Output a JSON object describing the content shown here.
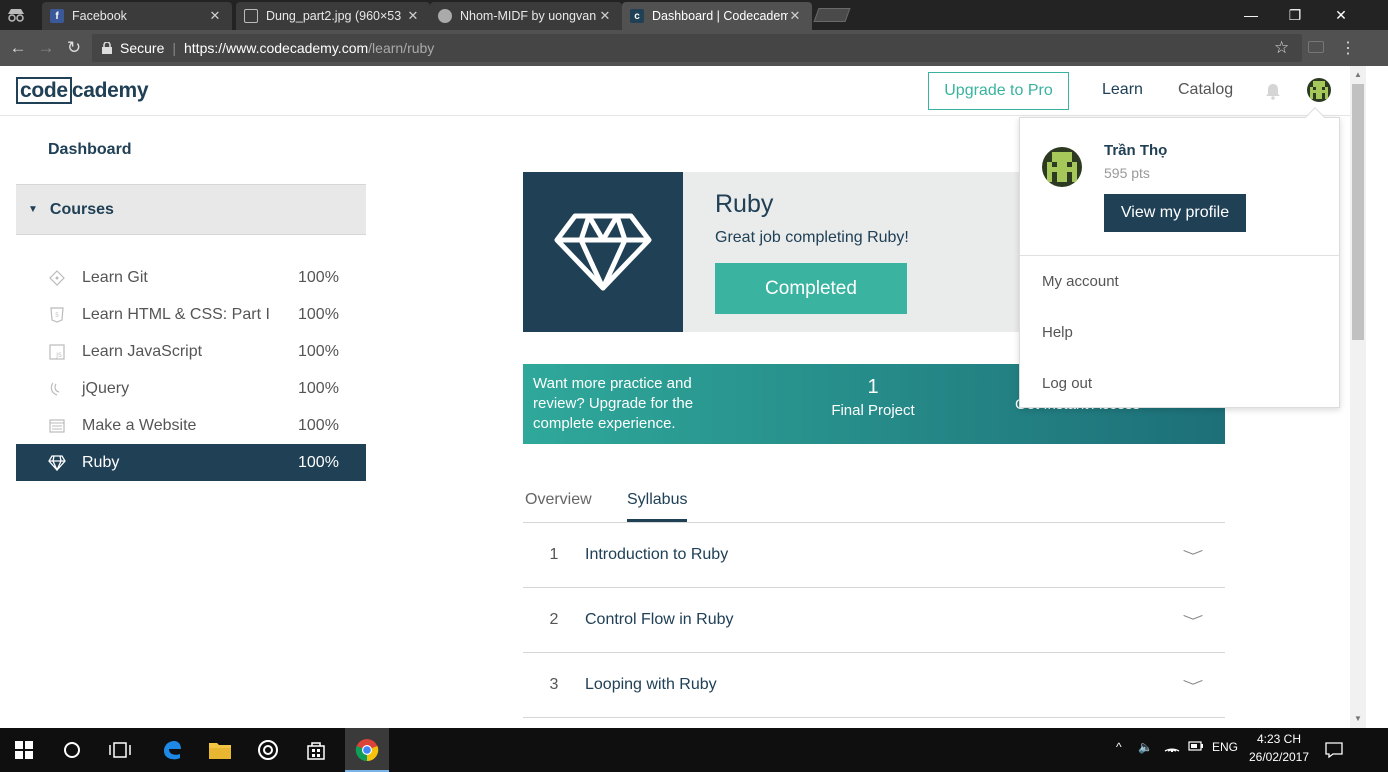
{
  "browser": {
    "tabs": [
      {
        "title": "Facebook",
        "favicon": "facebook-icon"
      },
      {
        "title": "Dung_part2.jpg (960×53",
        "favicon": "file-icon"
      },
      {
        "title": "Nhom-MIDF by uongvan",
        "favicon": "github-icon"
      },
      {
        "title": "Dashboard | Codecadem",
        "favicon": "codecademy-icon"
      }
    ],
    "secure_label": "Secure",
    "url_host": "https://www.codecademy.com",
    "url_path": "/learn/ruby"
  },
  "site": {
    "logo_left": "code",
    "logo_right": "cademy",
    "upgrade_label": "Upgrade to Pro",
    "nav_learn": "Learn",
    "nav_catalog": "Catalog"
  },
  "sidebar": {
    "dashboard": "Dashboard",
    "courses_heading": "Courses",
    "courses": [
      {
        "name": "Learn Git",
        "progress": "100%",
        "icon": "git-icon"
      },
      {
        "name": "Learn HTML & CSS: Part I",
        "progress": "100%",
        "icon": "html5-icon"
      },
      {
        "name": "Learn JavaScript",
        "progress": "100%",
        "icon": "js-icon"
      },
      {
        "name": "jQuery",
        "progress": "100%",
        "icon": "jquery-icon"
      },
      {
        "name": "Make a Website",
        "progress": "100%",
        "icon": "website-icon"
      },
      {
        "name": "Ruby",
        "progress": "100%",
        "icon": "ruby-gem-icon"
      }
    ]
  },
  "course": {
    "title": "Ruby",
    "subtitle": "Great job completing Ruby!",
    "status_button": "Completed"
  },
  "promo": {
    "text": "Want more practice and review? Upgrade for the complete experience.",
    "count": "1",
    "count_label": "Final Project",
    "cta": "Get Instant Access »"
  },
  "tabs": {
    "overview": "Overview",
    "syllabus": "Syllabus"
  },
  "syllabus": [
    {
      "num": "1",
      "name": "Introduction to Ruby"
    },
    {
      "num": "2",
      "name": "Control Flow in Ruby"
    },
    {
      "num": "3",
      "name": "Looping with Ruby"
    }
  ],
  "dropdown": {
    "user_name": "Trần Thọ",
    "points": "595 pts",
    "profile_button": "View my profile",
    "links": [
      "My account",
      "Help",
      "Log out"
    ]
  },
  "taskbar": {
    "language": "ENG",
    "time": "4:23 CH",
    "date": "26/02/2017"
  },
  "colors": {
    "brand_navy": "#204056",
    "accent_teal": "#3ab3a0"
  }
}
